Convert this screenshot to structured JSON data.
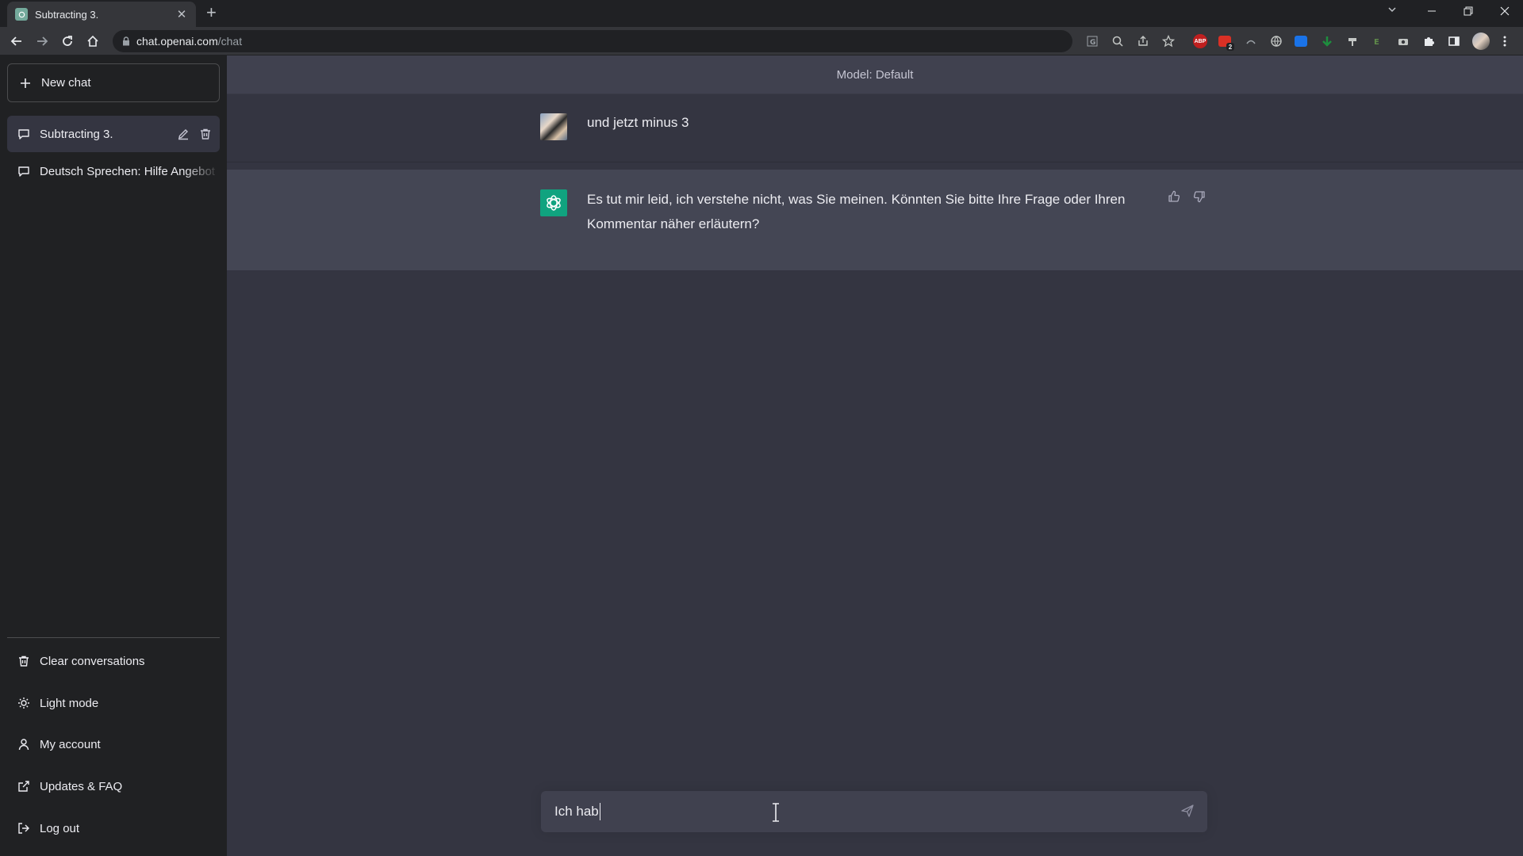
{
  "browser": {
    "tab_title": "Subtracting 3.",
    "tab_close": "✕",
    "new_tab": "+",
    "url_host": "chat.openai.com",
    "url_path": "/chat",
    "extension_abp": "ABP",
    "extension_badge": "2"
  },
  "sidebar": {
    "new_chat_label": "New chat",
    "conversations": [
      {
        "label": "Subtracting 3.",
        "active": true
      },
      {
        "label": "Deutsch Sprechen: Hilfe Angebot",
        "active": false
      }
    ],
    "menu": [
      {
        "label": "Clear conversations",
        "icon": "trash-icon"
      },
      {
        "label": "Light mode",
        "icon": "sun-icon"
      },
      {
        "label": "My account",
        "icon": "user-icon"
      },
      {
        "label": "Updates & FAQ",
        "icon": "external-link-icon"
      },
      {
        "label": "Log out",
        "icon": "logout-icon"
      }
    ]
  },
  "main": {
    "model_label": "Model: Default",
    "messages": [
      {
        "role": "user",
        "text": "und jetzt minus 3"
      },
      {
        "role": "assistant",
        "text": "Es tut mir leid, ich verstehe nicht, was Sie meinen. Könnten Sie bitte Ihre Frage oder Ihren Kommentar näher erläutern?"
      }
    ],
    "input_value": "Ich hab"
  },
  "colors": {
    "sidebar_bg": "#202123",
    "main_bg": "#343541",
    "assistant_bg": "#444654",
    "input_bg": "#40414f",
    "brand_green": "#10a37f"
  }
}
